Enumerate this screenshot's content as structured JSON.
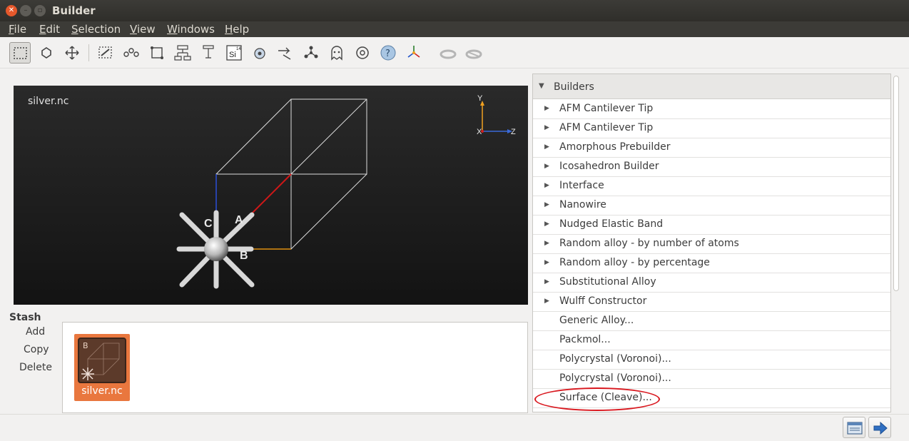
{
  "window": {
    "title": "Builder"
  },
  "menu": [
    "File",
    "Edit",
    "Selection",
    "View",
    "Windows",
    "Help"
  ],
  "toolbar": {
    "tools": [
      "select-rect-icon",
      "hexagon-select-icon",
      "move-icon",
      "lasso-icon",
      "chain-icon",
      "rotate-box-icon",
      "tree-icon",
      "tree-small-icon",
      "element-icon",
      "atom-icon",
      "arrow-cut-icon",
      "graph-icon",
      "ghost-icon",
      "gear-box-icon",
      "help-icon",
      "axes-icon",
      "ring-icon",
      "ring2-icon"
    ],
    "element_symbol": "Si",
    "element_number": "14"
  },
  "viewer": {
    "title": "silver.nc",
    "axis_labels": {
      "y": "Y",
      "x": "X",
      "z": "Z"
    },
    "lattice_labels": {
      "a": "A",
      "b": "B",
      "c": "C"
    }
  },
  "stash": {
    "title": "Stash",
    "add": "Add",
    "copy": "Copy",
    "delete": "Delete",
    "items": [
      {
        "label": "silver.nc",
        "letter": "B"
      }
    ]
  },
  "builders": {
    "header": "Builders",
    "groups": [
      "AFM Cantilever Tip",
      "AFM Cantilever Tip",
      "Amorphous Prebuilder",
      "Icosahedron Builder",
      "Interface",
      "Nanowire",
      "Nudged Elastic Band",
      "Random alloy - by number of atoms",
      "Random alloy - by percentage",
      "Substitutional Alloy",
      "Wulff Constructor"
    ],
    "actions": [
      "Generic Alloy...",
      "Packmol...",
      "Polycrystal (Voronoi)...",
      "Polycrystal (Voronoi)...",
      "Surface (Cleave)..."
    ],
    "highlight_color": "#d9181f"
  }
}
